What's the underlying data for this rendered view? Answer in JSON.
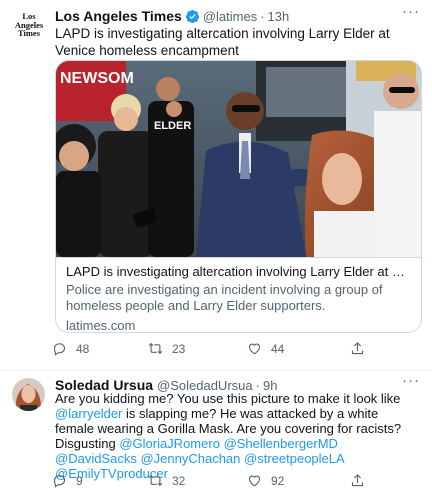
{
  "tweet1": {
    "author_name": "Los Angeles Times",
    "handle": "@latimes",
    "separator": "·",
    "time": "13h",
    "logo_lines": [
      "Los",
      "Angeles",
      "Times"
    ],
    "text": "LAPD is investigating altercation involving Larry Elder at Venice homeless encampment",
    "card": {
      "title": "LAPD is investigating altercation involving Larry Elder at Venice homel...",
      "description": "Police are investigating an incident involving a group of homeless people and Larry Elder supporters.",
      "domain": "latimes.com",
      "image_text": {
        "sign": "NEWSOM",
        "shirt": "ELDER"
      }
    },
    "actions": {
      "replies": "48",
      "retweets": "23",
      "likes": "44"
    }
  },
  "tweet2": {
    "author_name": "Soledad Ursua",
    "handle": "@SoledadUrsua",
    "separator": "·",
    "time": "9h",
    "text_parts": [
      "Are you kidding me? You use this picture to make it look like ",
      "@larryelder",
      " is slapping me? He was attacked by a white female wearing a Gorilla Mask. Are you covering for racists? Disgusting ",
      "@GloriaJRomero",
      " ",
      "@ShellenbergerMD",
      " ",
      "@DavidSacks",
      " ",
      "@JennyChachan",
      " ",
      "@streetpeopleLA",
      " ",
      "@EmilyTVproducer"
    ],
    "actions": {
      "replies": "9",
      "retweets": "32",
      "likes": "92"
    }
  },
  "more_glyph": "···",
  "icons": [
    "verified-badge-icon",
    "more-icon",
    "reply-icon",
    "retweet-icon",
    "like-icon",
    "share-icon"
  ],
  "colors": {
    "link": "#1d9bf0",
    "secondary_text": "#536471",
    "border": "#cfd9de",
    "verified": "#1d9bf0"
  }
}
